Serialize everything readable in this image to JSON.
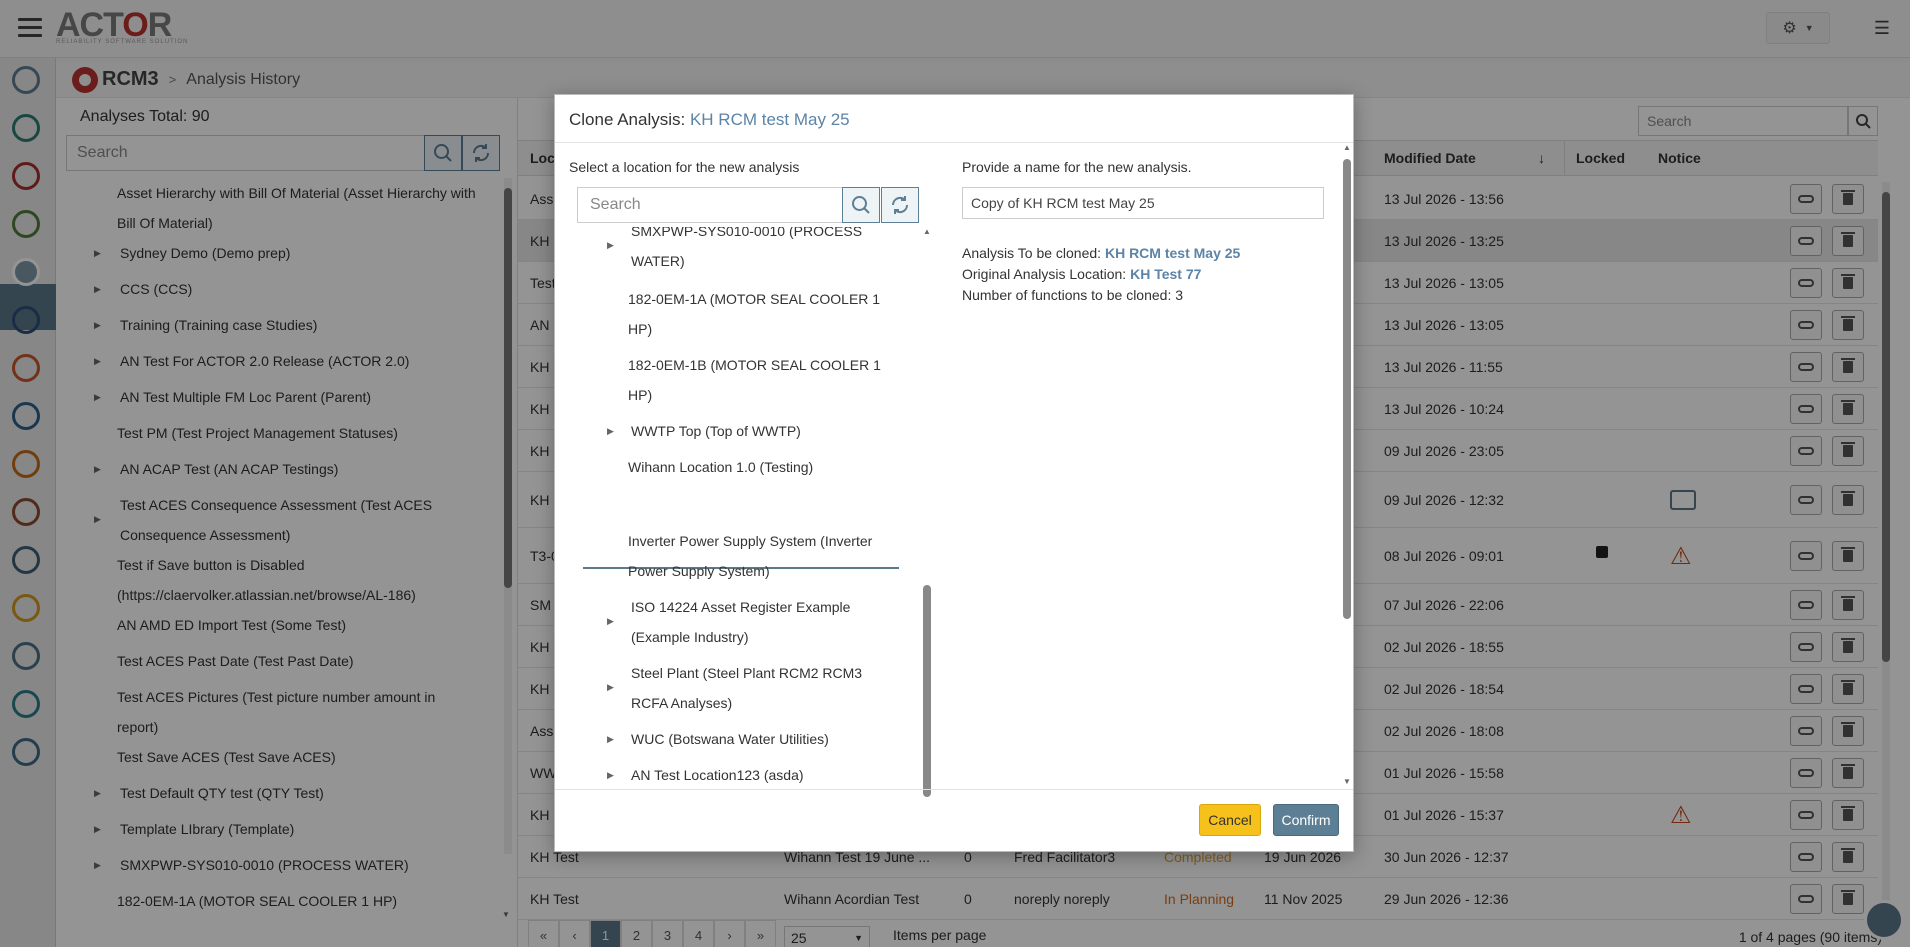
{
  "app": {
    "logo_text_1": "ACT",
    "logo_text_2": "O",
    "logo_text_3": "R",
    "logo_sub": "RELIABILITY SOFTWARE SOLUTION"
  },
  "breadcrumb": {
    "module": "RCM3",
    "separator": ">",
    "page": "Analysis History"
  },
  "left_panel": {
    "total": "Analyses Total: 90",
    "search_placeholder": "Search",
    "items": [
      {
        "label": "Asset Hierarchy with Bill Of Material (Asset Hierarchy with",
        "label2": "Bill Of Material)",
        "arrow": false
      },
      {
        "label": "Sydney Demo (Demo prep)",
        "arrow": true
      },
      {
        "label": "CCS (CCS)",
        "arrow": true
      },
      {
        "label": "Training (Training case Studies)",
        "arrow": true
      },
      {
        "label": "AN Test For ACTOR 2.0 Release (ACTOR 2.0)",
        "arrow": true
      },
      {
        "label": "AN Test Multiple FM Loc Parent (Parent)",
        "arrow": true
      },
      {
        "label": "Test PM (Test Project Management Statuses)",
        "arrow": false
      },
      {
        "label": "AN ACAP Test (AN ACAP Testings)",
        "arrow": true
      },
      {
        "label": "Test ACES Consequence Assessment (Test ACES",
        "label2": "Consequence Assessment)",
        "arrow": true
      },
      {
        "label": "Test if Save button is Disabled",
        "label2": "(https://claervolker.atlassian.net/browse/AL-186)",
        "arrow": false
      },
      {
        "label": "AN AMD ED Import Test (Some Test)",
        "arrow": false
      },
      {
        "label": "Test ACES Past Date (Test Past Date)",
        "arrow": false
      },
      {
        "label": "Test ACES Pictures (Test picture number amount in",
        "label2": "report)",
        "arrow": false
      },
      {
        "label": "Test Save ACES (Test Save ACES)",
        "arrow": false
      },
      {
        "label": "Test Default QTY test (QTY Test)",
        "arrow": true
      },
      {
        "label": "Template LIbrary (Template)",
        "arrow": true
      },
      {
        "label": "SMXPWP-SYS010-0010 (PROCESS WATER)",
        "arrow": true
      },
      {
        "label": "182-0EM-1A (MOTOR SEAL COOLER 1 HP)",
        "arrow": false
      }
    ]
  },
  "grid": {
    "search_placeholder": "Search",
    "headers": {
      "location": "Loc",
      "modified": "Modified Date",
      "locked": "Locked",
      "notice": "Notice"
    },
    "rows": [
      {
        "loc": "Ass",
        "modified": "13 Jul 2026 - 13:56"
      },
      {
        "loc": "KH",
        "modified": "13 Jul 2026 - 13:25"
      },
      {
        "loc": "Test",
        "modified": "13 Jul 2026 - 13:05"
      },
      {
        "loc": "AN",
        "modified": "13 Jul 2026 - 13:05"
      },
      {
        "loc": "KH",
        "modified": "13 Jul 2026 - 11:55"
      },
      {
        "loc": "KH",
        "modified": "13 Jul 2026 - 10:24"
      },
      {
        "loc": "KH",
        "modified": "09 Jul 2026 - 23:05"
      },
      {
        "loc": "KH",
        "modified": "09 Jul 2026 - 12:32"
      },
      {
        "loc": "T3-0",
        "modified": "08 Jul 2026 - 09:01"
      },
      {
        "loc": "SM",
        "modified": "07 Jul 2026 - 22:06"
      },
      {
        "loc": "KH",
        "modified": "02 Jul 2026 - 18:55"
      },
      {
        "loc": "KH",
        "modified": "02 Jul 2026 - 18:54"
      },
      {
        "loc": "Ass",
        "modified": "02 Jul 2026 - 18:08"
      },
      {
        "loc": "WW",
        "modified": "01 Jul 2026 - 15:58"
      },
      {
        "loc": "KH",
        "modified": "01 Jul 2026 - 15:37"
      },
      {
        "loc": "KH Test",
        "name": "Wihann Test 19 June ...",
        "num": "0",
        "facilitator": "Fred Facilitator3",
        "status": "Completed",
        "created": "19 Jun 2026",
        "modified": "30 Jun 2026 - 12:37"
      },
      {
        "loc": "KH Test",
        "name": "Wihann Acordian Test",
        "num": "0",
        "facilitator": "noreply noreply",
        "status": "In Planning",
        "created": "11 Nov 2025",
        "modified": "29 Jun 2026 - 12:36"
      }
    ],
    "status_colors": {
      "completed": "#e0a23a",
      "planning": "#d26a1e"
    }
  },
  "pager": {
    "first": "«",
    "prev": "‹",
    "pages": [
      "1",
      "2",
      "3",
      "4"
    ],
    "next": "›",
    "last": "»",
    "page_size": "25",
    "items_per_page": "Items per page",
    "info": "1 of 4 pages (90 items)"
  },
  "modal": {
    "title_prefix": "Clone Analysis: ",
    "title_name": "KH RCM test May 25",
    "left_title": "Select a location for the new analysis",
    "search_placeholder": "Search",
    "tree": [
      {
        "label": "SMXPWP-SYS010-0010 (PROCESS",
        "label2": "WATER)",
        "arrow": true
      },
      {
        "label": "182-0EM-1A (MOTOR SEAL COOLER 1",
        "label2": "HP)",
        "arrow": false
      },
      {
        "label": "182-0EM-1B (MOTOR SEAL COOLER 1",
        "label2": "HP)",
        "arrow": false
      },
      {
        "label": "WWTP Top (Top of WWTP)",
        "arrow": true
      },
      {
        "label": "Wihann Location 1.0 (Testing)",
        "arrow": false
      },
      {
        "label": "Inverter Power Supply System (Inverter",
        "label2": "Power Supply System)",
        "arrow": false
      },
      {
        "label": "ISO 14224 Asset Register Example",
        "label2": "(Example Industry)",
        "arrow": true
      },
      {
        "label": "Steel Plant (Steel Plant RCM2 RCM3",
        "label2": "RCFA Analyses)",
        "arrow": true
      },
      {
        "label": "WUC (Botswana Water Utilities)",
        "arrow": true
      },
      {
        "label": "AN Test Location123 (asda)",
        "arrow": true
      }
    ],
    "right_title": "Provide a name for the new analysis.",
    "name_value": "Copy of KH RCM test May 25",
    "to_clone_label": "Analysis To be cloned: ",
    "to_clone_value": "KH RCM test May 25",
    "orig_loc_label": "Original Analysis Location: ",
    "orig_loc_value": "KH Test 77",
    "functions_text": "Number of functions to be cloned: 3",
    "cancel": "Cancel",
    "confirm": "Confirm"
  },
  "colors": {
    "accent": "#5c7889",
    "link": "#5b84a6",
    "cancel": "#f7c11c",
    "brand_red": "#b8332f"
  }
}
